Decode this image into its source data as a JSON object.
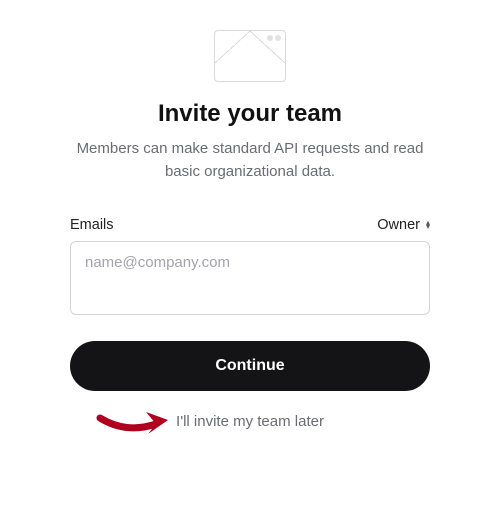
{
  "icon": {
    "name": "envelope-icon"
  },
  "heading": "Invite your team",
  "subheading": "Members can make standard API requests and read basic organizational data.",
  "form": {
    "emails_label": "Emails",
    "role_label": "Owner",
    "emails_placeholder": "name@company.com",
    "emails_value": ""
  },
  "actions": {
    "continue_label": "Continue",
    "skip_label": "I'll invite my team later"
  },
  "annotation": {
    "arrow_color": "#b00020"
  }
}
